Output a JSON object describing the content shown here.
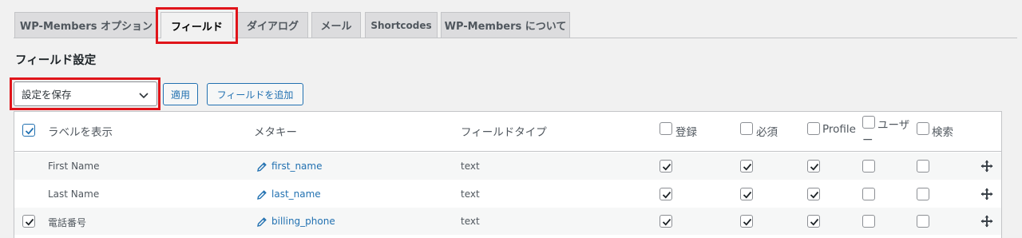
{
  "tabs": [
    {
      "label": "WP-Members オプション",
      "active": false
    },
    {
      "label": "フィールド",
      "active": true
    },
    {
      "label": "ダイアログ",
      "active": false
    },
    {
      "label": "メール",
      "active": false
    },
    {
      "label": "Shortcodes",
      "active": false
    },
    {
      "label": "WP-Members について",
      "active": false
    }
  ],
  "heading": "フィールド設定",
  "bulk_select": {
    "value": "設定を保存"
  },
  "apply_button": "適用",
  "add_field_button": "フィールドを追加",
  "columns": {
    "label": "ラベルを表示",
    "meta_key": "メタキー",
    "field_type": "フィールドタイプ",
    "register": "登録",
    "required": "必須",
    "profile": "Profile",
    "user_line1": "ユーザ",
    "user_line2": "ー",
    "search": "検索"
  },
  "rows": [
    {
      "label": "First Name",
      "meta_key": "first_name",
      "type": "text",
      "select": false,
      "register": true,
      "required": true,
      "profile": true,
      "user": false,
      "search": false
    },
    {
      "label": "Last Name",
      "meta_key": "last_name",
      "type": "text",
      "select": false,
      "register": true,
      "required": true,
      "profile": true,
      "user": false,
      "search": false
    },
    {
      "label": "電話番号",
      "meta_key": "billing_phone",
      "type": "text",
      "select": true,
      "register": true,
      "required": true,
      "profile": true,
      "user": false,
      "search": false
    }
  ],
  "colors": {
    "accent": "#2271b1",
    "highlight": "#e0141a"
  },
  "icons": {
    "edit": "pencil-icon",
    "move": "move-icon",
    "dropdown": "chevron-down-icon"
  }
}
